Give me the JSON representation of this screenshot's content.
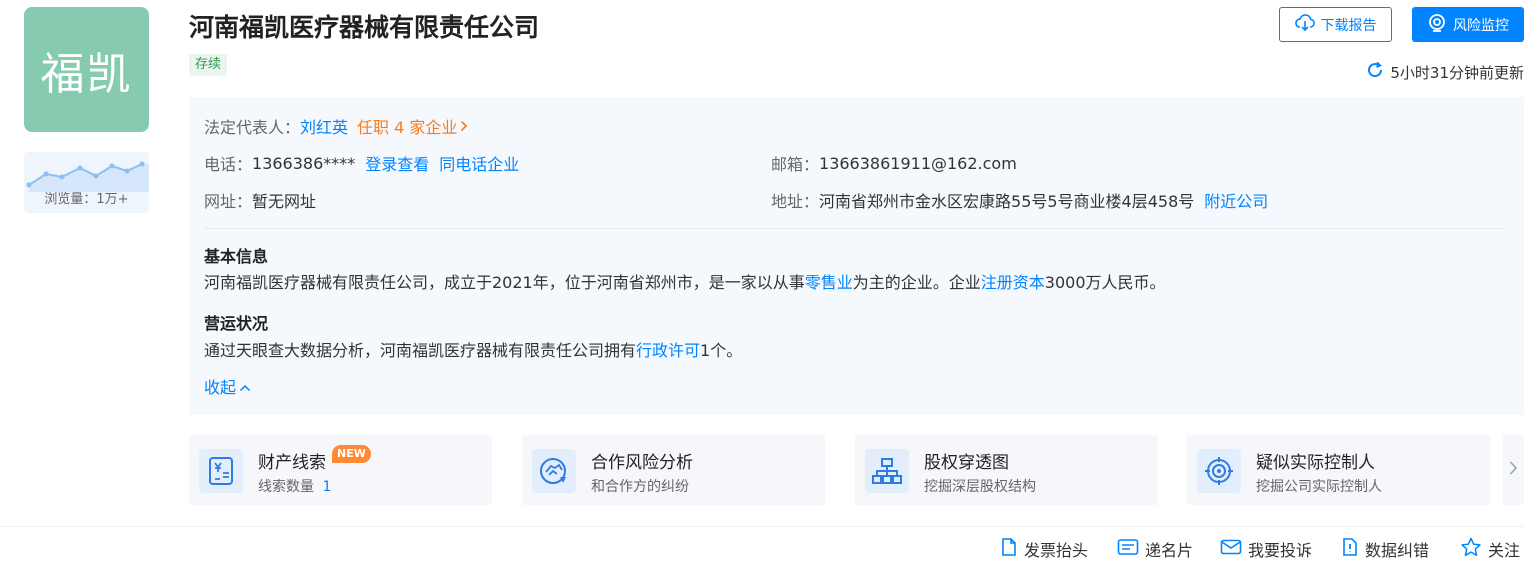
{
  "company": {
    "logo_text": "福凯",
    "views_label": "浏览量：1万+",
    "name": "河南福凯医疗器械有限责任公司",
    "status": "存续"
  },
  "header_actions": {
    "download_report": "下载报告",
    "risk_monitor": "风险监控",
    "updated": "5小时31分钟前更新"
  },
  "info": {
    "legal_rep_label": "法定代表人：",
    "legal_rep_name": "刘红英",
    "legal_rep_roles": "任职 4 家企业",
    "phone_label": "电话：",
    "phone_value": "1366386****",
    "phone_login": "登录查看",
    "phone_same": "同电话企业",
    "email_label": "邮箱：",
    "email_value": "13663861911@162.com",
    "website_label": "网址：",
    "website_value": "暂无网址",
    "address_label": "地址：",
    "address_value": "河南省郑州市金水区宏康路55号5号商业楼4层458号",
    "address_nearby": "附近公司"
  },
  "basic_info": {
    "title": "基本信息",
    "text_1": "河南福凯医疗器械有限责任公司，成立于2021年，位于河南省郑州市，是一家以从事",
    "link_industry": "零售业",
    "text_2": "为主的企业。企业",
    "link_capital": "注册资本",
    "text_3": "3000万人民币。"
  },
  "operation": {
    "title": "营运状况",
    "text_1": "通过天眼查大数据分析，河南福凯医疗器械有限责任公司拥有",
    "link_license": "行政许可",
    "text_2": "1个。",
    "collapse": "收起"
  },
  "cards": [
    {
      "title": "财产线索",
      "badge": "NEW",
      "sub": "线索数量",
      "count": "1"
    },
    {
      "title": "合作风险分析",
      "sub": "和合作方的纠纷"
    },
    {
      "title": "股权穿透图",
      "sub": "挖掘深层股权结构"
    },
    {
      "title": "疑似实际控制人",
      "sub": "挖掘公司实际控制人"
    }
  ],
  "bottom_actions": {
    "invoice": "发票抬头",
    "card": "递名片",
    "complain": "我要投诉",
    "correct": "数据纠错",
    "follow": "关注"
  },
  "colors": {
    "accent": "#0084ff",
    "logo_bg": "#86cbb0",
    "orange": "#ff7a16",
    "status_green": "#2e9b4f"
  }
}
